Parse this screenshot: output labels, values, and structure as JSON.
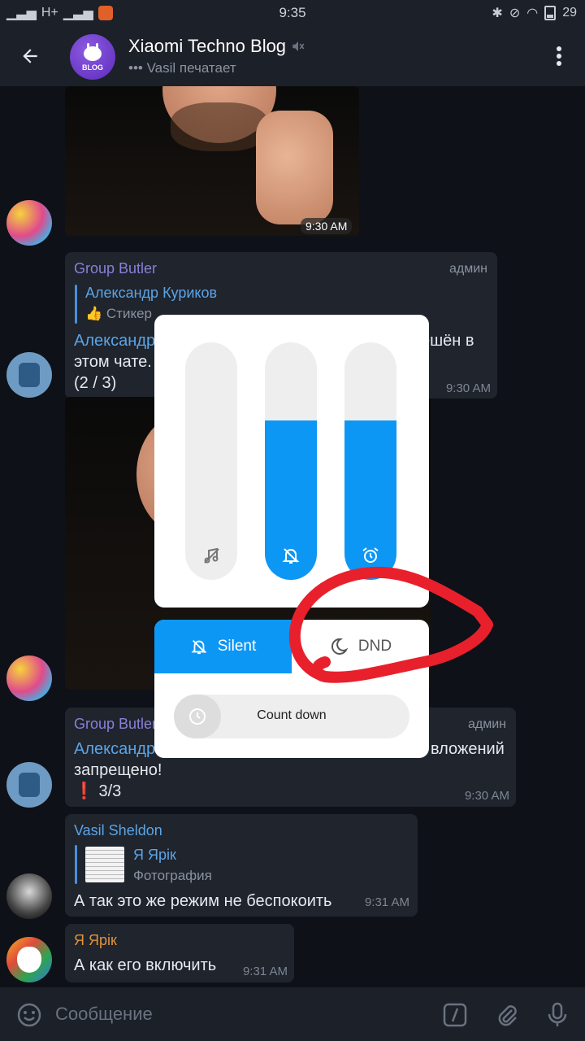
{
  "status_bar": {
    "network": "H+",
    "time": "9:35",
    "battery": "29"
  },
  "header": {
    "title": "Xiaomi Techno Blog",
    "subtitle": "Vasil печатает",
    "avatar_text": "BLOG"
  },
  "messages": {
    "photo1_time": "9:30 AM",
    "msg1": {
      "sender": "Group Butler",
      "role": "админ",
      "reply_name": "Александр Куриков",
      "reply_sub": "👍 Стикер",
      "line1_link": "Александр",
      "line1_rest": "ешён в",
      "line2": "этом чате.",
      "line3": "(2  /  3)",
      "time": "9:30 AM"
    },
    "msg2": {
      "sender": "Group Butler",
      "role": "админ",
      "line1_link": "Александр",
      "line1_rest": "вложений",
      "line2": "запрещено!",
      "line3": "❗ 3/3",
      "time": "9:30 AM"
    },
    "msg3": {
      "sender": "Vasil Sheldon",
      "reply_name": "Я Ярік",
      "reply_sub": "Фотография",
      "text": "А так это же режим не беспокоить",
      "time": "9:31 AM"
    },
    "msg4": {
      "sender": "Я Ярік",
      "text": "А как его включить",
      "time": "9:31 AM"
    }
  },
  "composer": {
    "placeholder": "Сообщение"
  },
  "volume_panel": {
    "sliders": [
      {
        "name": "media",
        "level": 0.0,
        "icon": "music-off-icon"
      },
      {
        "name": "ringer",
        "level": 0.67,
        "icon": "bell-off-icon"
      },
      {
        "name": "alarm",
        "level": 0.67,
        "icon": "alarm-icon"
      }
    ],
    "mode_silent": "Silent",
    "mode_dnd": "DND",
    "countdown": "Count down"
  },
  "colors": {
    "accent": "#0d97f5",
    "annotation": "#e8202c",
    "group_butler": "#8b7fd8",
    "vasil": "#5ba4e6",
    "yarik": "#e0943a"
  }
}
